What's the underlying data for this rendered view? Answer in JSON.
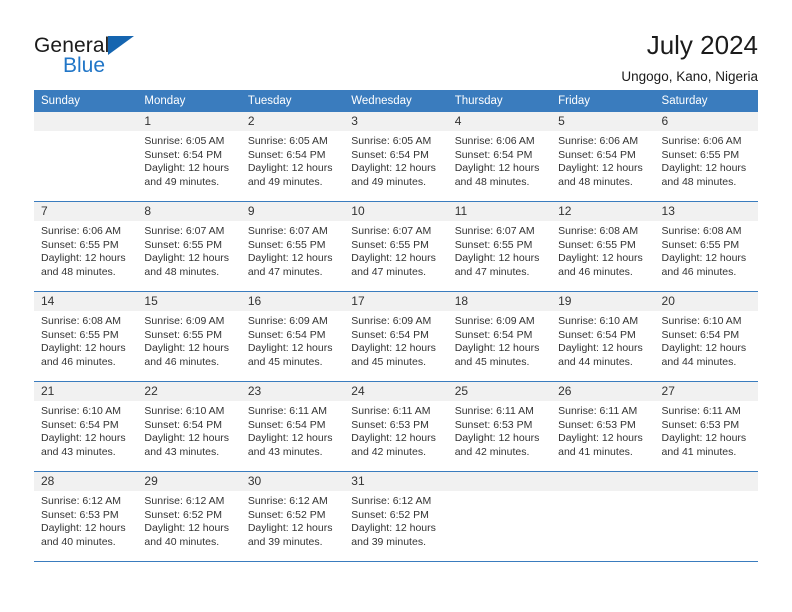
{
  "brand": {
    "name_top": "General",
    "name_bottom": "Blue",
    "accent_color": "#2176c7",
    "triangle_color": "#1565b0"
  },
  "header": {
    "title": "July 2024",
    "subtitle": "Ungogo, Kano, Nigeria"
  },
  "calendar": {
    "header_bg": "#3a7cbe",
    "daynum_bg": "#f1f1f1",
    "weekdays": [
      "Sunday",
      "Monday",
      "Tuesday",
      "Wednesday",
      "Thursday",
      "Friday",
      "Saturday"
    ],
    "weeks": [
      [
        {
          "day": "",
          "lines": []
        },
        {
          "day": "1",
          "lines": [
            "Sunrise: 6:05 AM",
            "Sunset: 6:54 PM",
            "Daylight: 12 hours",
            "and 49 minutes."
          ]
        },
        {
          "day": "2",
          "lines": [
            "Sunrise: 6:05 AM",
            "Sunset: 6:54 PM",
            "Daylight: 12 hours",
            "and 49 minutes."
          ]
        },
        {
          "day": "3",
          "lines": [
            "Sunrise: 6:05 AM",
            "Sunset: 6:54 PM",
            "Daylight: 12 hours",
            "and 49 minutes."
          ]
        },
        {
          "day": "4",
          "lines": [
            "Sunrise: 6:06 AM",
            "Sunset: 6:54 PM",
            "Daylight: 12 hours",
            "and 48 minutes."
          ]
        },
        {
          "day": "5",
          "lines": [
            "Sunrise: 6:06 AM",
            "Sunset: 6:54 PM",
            "Daylight: 12 hours",
            "and 48 minutes."
          ]
        },
        {
          "day": "6",
          "lines": [
            "Sunrise: 6:06 AM",
            "Sunset: 6:55 PM",
            "Daylight: 12 hours",
            "and 48 minutes."
          ]
        }
      ],
      [
        {
          "day": "7",
          "lines": [
            "Sunrise: 6:06 AM",
            "Sunset: 6:55 PM",
            "Daylight: 12 hours",
            "and 48 minutes."
          ]
        },
        {
          "day": "8",
          "lines": [
            "Sunrise: 6:07 AM",
            "Sunset: 6:55 PM",
            "Daylight: 12 hours",
            "and 48 minutes."
          ]
        },
        {
          "day": "9",
          "lines": [
            "Sunrise: 6:07 AM",
            "Sunset: 6:55 PM",
            "Daylight: 12 hours",
            "and 47 minutes."
          ]
        },
        {
          "day": "10",
          "lines": [
            "Sunrise: 6:07 AM",
            "Sunset: 6:55 PM",
            "Daylight: 12 hours",
            "and 47 minutes."
          ]
        },
        {
          "day": "11",
          "lines": [
            "Sunrise: 6:07 AM",
            "Sunset: 6:55 PM",
            "Daylight: 12 hours",
            "and 47 minutes."
          ]
        },
        {
          "day": "12",
          "lines": [
            "Sunrise: 6:08 AM",
            "Sunset: 6:55 PM",
            "Daylight: 12 hours",
            "and 46 minutes."
          ]
        },
        {
          "day": "13",
          "lines": [
            "Sunrise: 6:08 AM",
            "Sunset: 6:55 PM",
            "Daylight: 12 hours",
            "and 46 minutes."
          ]
        }
      ],
      [
        {
          "day": "14",
          "lines": [
            "Sunrise: 6:08 AM",
            "Sunset: 6:55 PM",
            "Daylight: 12 hours",
            "and 46 minutes."
          ]
        },
        {
          "day": "15",
          "lines": [
            "Sunrise: 6:09 AM",
            "Sunset: 6:55 PM",
            "Daylight: 12 hours",
            "and 46 minutes."
          ]
        },
        {
          "day": "16",
          "lines": [
            "Sunrise: 6:09 AM",
            "Sunset: 6:54 PM",
            "Daylight: 12 hours",
            "and 45 minutes."
          ]
        },
        {
          "day": "17",
          "lines": [
            "Sunrise: 6:09 AM",
            "Sunset: 6:54 PM",
            "Daylight: 12 hours",
            "and 45 minutes."
          ]
        },
        {
          "day": "18",
          "lines": [
            "Sunrise: 6:09 AM",
            "Sunset: 6:54 PM",
            "Daylight: 12 hours",
            "and 45 minutes."
          ]
        },
        {
          "day": "19",
          "lines": [
            "Sunrise: 6:10 AM",
            "Sunset: 6:54 PM",
            "Daylight: 12 hours",
            "and 44 minutes."
          ]
        },
        {
          "day": "20",
          "lines": [
            "Sunrise: 6:10 AM",
            "Sunset: 6:54 PM",
            "Daylight: 12 hours",
            "and 44 minutes."
          ]
        }
      ],
      [
        {
          "day": "21",
          "lines": [
            "Sunrise: 6:10 AM",
            "Sunset: 6:54 PM",
            "Daylight: 12 hours",
            "and 43 minutes."
          ]
        },
        {
          "day": "22",
          "lines": [
            "Sunrise: 6:10 AM",
            "Sunset: 6:54 PM",
            "Daylight: 12 hours",
            "and 43 minutes."
          ]
        },
        {
          "day": "23",
          "lines": [
            "Sunrise: 6:11 AM",
            "Sunset: 6:54 PM",
            "Daylight: 12 hours",
            "and 43 minutes."
          ]
        },
        {
          "day": "24",
          "lines": [
            "Sunrise: 6:11 AM",
            "Sunset: 6:53 PM",
            "Daylight: 12 hours",
            "and 42 minutes."
          ]
        },
        {
          "day": "25",
          "lines": [
            "Sunrise: 6:11 AM",
            "Sunset: 6:53 PM",
            "Daylight: 12 hours",
            "and 42 minutes."
          ]
        },
        {
          "day": "26",
          "lines": [
            "Sunrise: 6:11 AM",
            "Sunset: 6:53 PM",
            "Daylight: 12 hours",
            "and 41 minutes."
          ]
        },
        {
          "day": "27",
          "lines": [
            "Sunrise: 6:11 AM",
            "Sunset: 6:53 PM",
            "Daylight: 12 hours",
            "and 41 minutes."
          ]
        }
      ],
      [
        {
          "day": "28",
          "lines": [
            "Sunrise: 6:12 AM",
            "Sunset: 6:53 PM",
            "Daylight: 12 hours",
            "and 40 minutes."
          ]
        },
        {
          "day": "29",
          "lines": [
            "Sunrise: 6:12 AM",
            "Sunset: 6:52 PM",
            "Daylight: 12 hours",
            "and 40 minutes."
          ]
        },
        {
          "day": "30",
          "lines": [
            "Sunrise: 6:12 AM",
            "Sunset: 6:52 PM",
            "Daylight: 12 hours",
            "and 39 minutes."
          ]
        },
        {
          "day": "31",
          "lines": [
            "Sunrise: 6:12 AM",
            "Sunset: 6:52 PM",
            "Daylight: 12 hours",
            "and 39 minutes."
          ]
        },
        {
          "day": "",
          "lines": []
        },
        {
          "day": "",
          "lines": []
        },
        {
          "day": "",
          "lines": []
        }
      ]
    ]
  }
}
